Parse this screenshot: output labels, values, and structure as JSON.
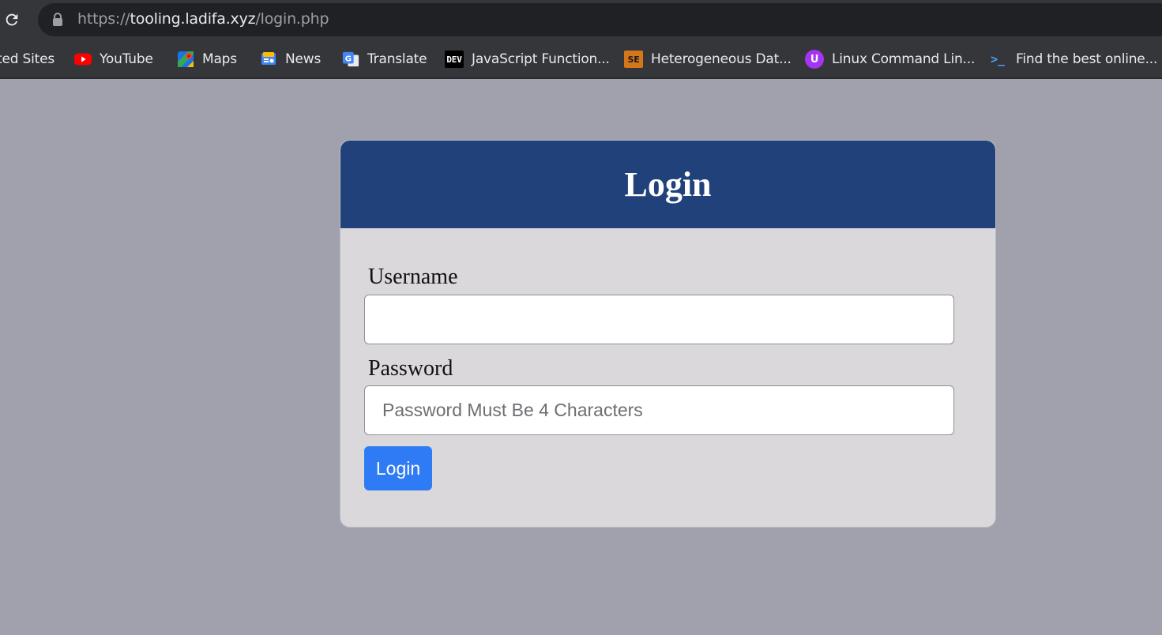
{
  "browser": {
    "url_scheme": "https://",
    "url_host": "tooling.ladifa.xyz",
    "url_path": "/login.php",
    "bookmarks": [
      {
        "label": "ted Sites",
        "icon": "none"
      },
      {
        "label": "YouTube",
        "icon": "youtube-icon"
      },
      {
        "label": "Maps",
        "icon": "maps-icon"
      },
      {
        "label": "News",
        "icon": "news-icon"
      },
      {
        "label": "Translate",
        "icon": "translate-icon"
      },
      {
        "label": "JavaScript Function...",
        "icon": "dev-icon",
        "icon_text": "DEV"
      },
      {
        "label": "Heterogeneous Dat...",
        "icon": "se-icon",
        "icon_text": "SE"
      },
      {
        "label": "Linux Command Lin...",
        "icon": "udemy-icon",
        "icon_text": "U"
      },
      {
        "label": "Find the best online...",
        "icon": "terminal-icon",
        "icon_text": ">_"
      }
    ]
  },
  "login": {
    "title": "Login",
    "username_label": "Username",
    "username_value": "",
    "password_label": "Password",
    "password_placeholder": "Password Must Be 4 Characters",
    "submit_label": "Login"
  },
  "colors": {
    "page_bg": "#a1a0ad",
    "header_bg": "#21417b",
    "card_bg": "#dad8da",
    "button_bg": "#2f7bf5"
  }
}
